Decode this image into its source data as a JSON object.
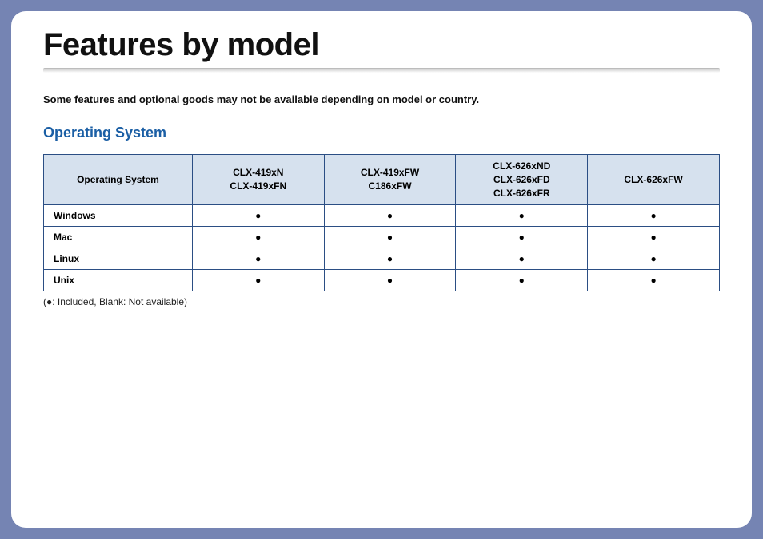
{
  "page": {
    "title": "Features by model",
    "intro": "Some features and optional goods may not be available depending on model or country.",
    "section_heading": "Operating System",
    "legend": "(●: Included, Blank: Not available)"
  },
  "table": {
    "header_first": "Operating System",
    "columns": [
      [
        "CLX-419xN",
        "CLX-419xFN"
      ],
      [
        "CLX-419xFW",
        "C186xFW"
      ],
      [
        "CLX-626xND",
        "CLX-626xFD",
        "CLX-626xFR"
      ],
      [
        "CLX-626xFW"
      ]
    ],
    "rows": [
      {
        "label": "Windows",
        "cells": [
          "●",
          "●",
          "●",
          "●"
        ]
      },
      {
        "label": "Mac",
        "cells": [
          "●",
          "●",
          "●",
          "●"
        ]
      },
      {
        "label": "Linux",
        "cells": [
          "●",
          "●",
          "●",
          "●"
        ]
      },
      {
        "label": "Unix",
        "cells": [
          "●",
          "●",
          "●",
          "●"
        ]
      }
    ]
  }
}
